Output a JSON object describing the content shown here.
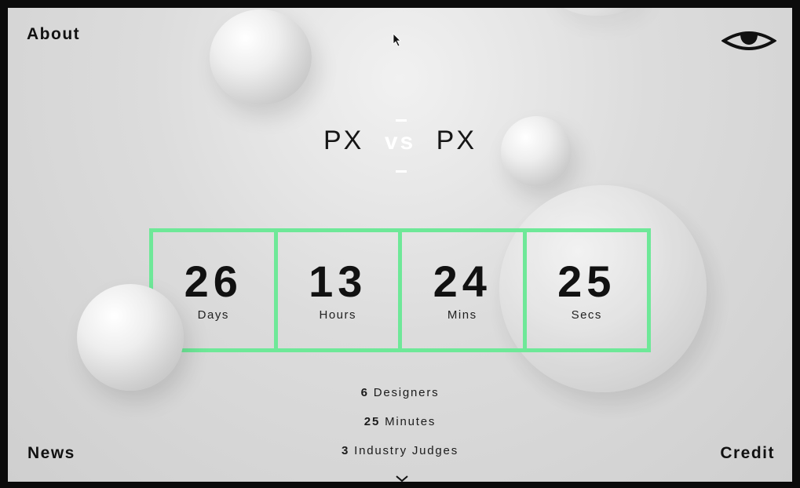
{
  "nav": {
    "about": "About",
    "news": "News",
    "credit": "Credit"
  },
  "icons": {
    "menu": "eye-icon",
    "scroll": "chevron-down-icon",
    "pointer": "cursor-icon"
  },
  "title": {
    "left": "PX",
    "vs": "vs",
    "right": "PX"
  },
  "countdown": [
    {
      "value": "26",
      "unit": "Days"
    },
    {
      "value": "13",
      "unit": "Hours"
    },
    {
      "value": "24",
      "unit": "Mins"
    },
    {
      "value": "25",
      "unit": "Secs"
    }
  ],
  "facts": [
    {
      "num": "6",
      "text": "Designers"
    },
    {
      "num": "25",
      "text": "Minutes"
    },
    {
      "num": "3",
      "text": "Industry Judges"
    }
  ],
  "colors": {
    "accent": "#6ee898",
    "background": "#dcdcdc",
    "text": "#111111"
  }
}
